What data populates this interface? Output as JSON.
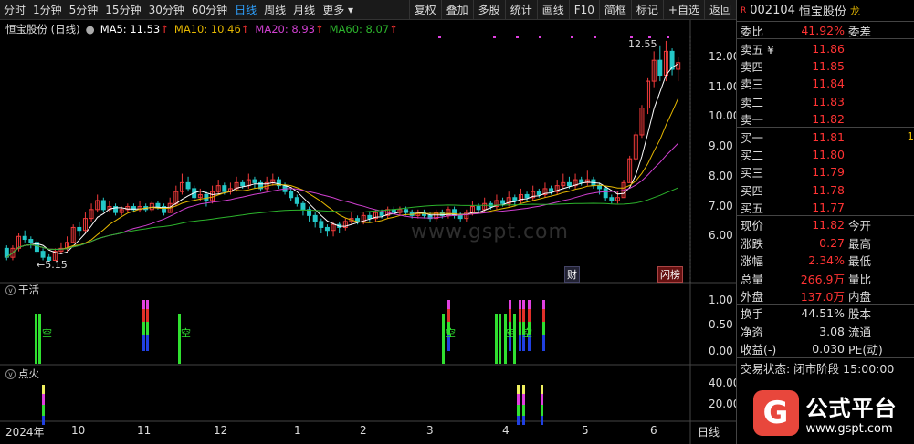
{
  "toolbar": {
    "periods": [
      "分时",
      "1分钟",
      "5分钟",
      "15分钟",
      "30分钟",
      "60分钟",
      "日线",
      "周线",
      "月线",
      "更多"
    ],
    "more_arrow": "▾",
    "active_period": "日线",
    "tools": [
      "复权",
      "叠加",
      "多股",
      "统计",
      "画线",
      "F10",
      "简框",
      "标记",
      "+自选",
      "返回"
    ]
  },
  "legend": {
    "title": "恒宝股份 (日线)",
    "ma5": "MA5: 11.53",
    "ma10": "MA10: 10.46",
    "ma20": "MA20: 8.93",
    "ma60": "MA60: 8.07",
    "arrow": "↑",
    "colors": {
      "ma5": "#ffffff",
      "ma10": "#e6b800",
      "ma20": "#d040d0",
      "ma60": "#2cb32c",
      "up": "#f03a3a",
      "down": "#24c7c7",
      "sub_yellow": "#f0f060",
      "sub_magenta": "#e040e0",
      "sub_red": "#e0302a",
      "sub_green": "#30e030",
      "sub_blue": "#2040e0"
    }
  },
  "price_axis": {
    "ticks": [
      "12.00",
      "11.00",
      "10.00",
      "9.00",
      "8.00",
      "7.00",
      "6.00"
    ]
  },
  "annotations": {
    "high": "12.55",
    "low": "5.15",
    "tag_cai": "财",
    "tag_shi": "闪榜"
  },
  "sub1": {
    "title": "干活",
    "ticks": [
      "1.00",
      "0.50",
      "0.00"
    ],
    "label": "空"
  },
  "sub2": {
    "title": "点火",
    "ticks": [
      "40.00",
      "20.00"
    ]
  },
  "x_axis": {
    "labels": [
      "2024年",
      "10",
      "11",
      "12",
      "1",
      "2",
      "3",
      "4",
      "5",
      "6"
    ],
    "right_label": "日线"
  },
  "watermark": "www.gspt.com",
  "chart_data": {
    "type": "candlestick",
    "ylim": [
      5.0,
      12.7
    ],
    "candles": [
      [
        5.6,
        5.3,
        5.7,
        5.2
      ],
      [
        5.3,
        5.6,
        5.7,
        5.2
      ],
      [
        5.6,
        6.0,
        6.1,
        5.5
      ],
      [
        6.0,
        5.9,
        6.2,
        5.8
      ],
      [
        5.9,
        5.8,
        6.0,
        5.6
      ],
      [
        5.8,
        5.5,
        5.9,
        5.4
      ],
      [
        5.5,
        5.3,
        5.6,
        5.2
      ],
      [
        5.3,
        5.2,
        5.4,
        5.15
      ],
      [
        5.2,
        5.5,
        5.6,
        5.2
      ],
      [
        5.5,
        5.6,
        5.8,
        5.4
      ],
      [
        5.6,
        5.8,
        6.0,
        5.5
      ],
      [
        5.8,
        6.3,
        6.4,
        5.8
      ],
      [
        6.3,
        6.2,
        6.5,
        6.0
      ],
      [
        6.2,
        6.6,
        6.8,
        6.1
      ],
      [
        6.6,
        6.9,
        7.1,
        6.5
      ],
      [
        6.9,
        7.2,
        7.4,
        6.8
      ],
      [
        7.2,
        6.9,
        7.3,
        6.8
      ],
      [
        6.9,
        7.0,
        7.2,
        6.8
      ],
      [
        7.0,
        6.8,
        7.1,
        6.7
      ],
      [
        6.8,
        6.9,
        7.0,
        6.7
      ],
      [
        6.9,
        7.0,
        7.1,
        6.8
      ],
      [
        7.0,
        6.9,
        7.1,
        6.8
      ],
      [
        6.9,
        7.0,
        7.2,
        6.8
      ],
      [
        7.0,
        6.9,
        7.1,
        6.8
      ],
      [
        6.9,
        7.1,
        7.2,
        6.8
      ],
      [
        7.1,
        7.0,
        7.2,
        6.9
      ],
      [
        7.0,
        6.8,
        7.1,
        6.7
      ],
      [
        6.8,
        7.1,
        7.3,
        6.8
      ],
      [
        7.1,
        7.5,
        7.7,
        7.0
      ],
      [
        7.5,
        7.8,
        8.1,
        7.4
      ],
      [
        7.8,
        7.6,
        8.0,
        7.5
      ],
      [
        7.6,
        7.3,
        7.7,
        7.2
      ],
      [
        7.3,
        7.4,
        7.6,
        7.2
      ],
      [
        7.4,
        7.2,
        7.5,
        7.0
      ],
      [
        7.2,
        7.5,
        7.7,
        7.1
      ],
      [
        7.5,
        7.7,
        7.9,
        7.4
      ],
      [
        7.7,
        7.5,
        7.8,
        7.4
      ],
      [
        7.5,
        7.6,
        7.8,
        7.4
      ],
      [
        7.6,
        7.8,
        8.0,
        7.5
      ],
      [
        7.8,
        7.7,
        7.9,
        7.6
      ],
      [
        7.7,
        7.9,
        8.1,
        7.6
      ],
      [
        7.9,
        7.8,
        8.0,
        7.6
      ],
      [
        7.8,
        7.6,
        7.9,
        7.5
      ],
      [
        7.6,
        7.8,
        8.0,
        7.5
      ],
      [
        7.8,
        7.9,
        8.1,
        7.7
      ],
      [
        7.9,
        7.7,
        8.0,
        7.6
      ],
      [
        7.7,
        7.5,
        7.8,
        7.4
      ],
      [
        7.5,
        7.3,
        7.6,
        7.2
      ],
      [
        7.3,
        7.1,
        7.4,
        7.0
      ],
      [
        7.1,
        6.9,
        7.2,
        6.7
      ],
      [
        6.9,
        6.7,
        7.0,
        6.5
      ],
      [
        6.7,
        6.5,
        6.8,
        6.3
      ],
      [
        6.5,
        6.3,
        6.6,
        6.1
      ],
      [
        6.3,
        6.2,
        6.4,
        6.0
      ],
      [
        6.2,
        6.4,
        6.5,
        6.0
      ],
      [
        6.4,
        6.3,
        6.5,
        6.1
      ],
      [
        6.3,
        6.5,
        6.6,
        6.2
      ],
      [
        6.5,
        6.6,
        6.8,
        6.4
      ],
      [
        6.6,
        6.5,
        6.7,
        6.4
      ],
      [
        6.5,
        6.7,
        6.8,
        6.4
      ],
      [
        6.7,
        6.6,
        6.8,
        6.5
      ],
      [
        6.6,
        6.8,
        6.9,
        6.5
      ],
      [
        6.8,
        6.7,
        6.9,
        6.6
      ],
      [
        6.7,
        6.9,
        7.0,
        6.6
      ],
      [
        6.9,
        6.8,
        7.0,
        6.7
      ],
      [
        6.8,
        6.9,
        7.0,
        6.7
      ],
      [
        6.9,
        6.8,
        7.0,
        6.7
      ],
      [
        6.8,
        6.7,
        6.9,
        6.6
      ],
      [
        6.7,
        6.8,
        6.9,
        6.6
      ],
      [
        6.8,
        6.7,
        6.9,
        6.6
      ],
      [
        6.7,
        6.6,
        6.8,
        6.5
      ],
      [
        6.6,
        6.8,
        6.9,
        6.5
      ],
      [
        6.8,
        6.7,
        6.9,
        6.6
      ],
      [
        6.7,
        6.9,
        7.0,
        6.6
      ],
      [
        6.9,
        6.7,
        7.0,
        6.6
      ],
      [
        6.7,
        6.6,
        6.8,
        6.5
      ],
      [
        6.6,
        6.8,
        6.9,
        6.5
      ],
      [
        6.8,
        7.0,
        7.2,
        6.7
      ],
      [
        7.0,
        6.9,
        7.1,
        6.8
      ],
      [
        6.9,
        7.1,
        7.3,
        6.8
      ],
      [
        7.1,
        7.0,
        7.2,
        6.9
      ],
      [
        7.0,
        7.2,
        7.4,
        6.9
      ],
      [
        7.2,
        7.1,
        7.3,
        7.0
      ],
      [
        7.1,
        7.3,
        7.5,
        7.0
      ],
      [
        7.3,
        7.2,
        7.4,
        7.0
      ],
      [
        7.2,
        7.4,
        7.6,
        7.1
      ],
      [
        7.4,
        7.3,
        7.5,
        7.2
      ],
      [
        7.3,
        7.5,
        7.7,
        7.2
      ],
      [
        7.5,
        7.4,
        7.6,
        7.3
      ],
      [
        7.4,
        7.6,
        7.8,
        7.3
      ],
      [
        7.6,
        7.5,
        7.7,
        7.4
      ],
      [
        7.5,
        7.7,
        7.9,
        7.4
      ],
      [
        7.7,
        7.8,
        8.1,
        7.6
      ],
      [
        7.8,
        7.7,
        8.0,
        7.6
      ],
      [
        7.7,
        7.9,
        8.1,
        7.6
      ],
      [
        7.9,
        7.8,
        8.0,
        7.7
      ],
      [
        7.8,
        7.9,
        8.2,
        7.7
      ],
      [
        7.9,
        7.7,
        8.0,
        7.6
      ],
      [
        7.7,
        7.6,
        7.8,
        7.4
      ],
      [
        7.6,
        7.3,
        7.7,
        7.2
      ],
      [
        7.3,
        7.2,
        7.4,
        7.1
      ],
      [
        7.2,
        7.3,
        7.5,
        7.1
      ],
      [
        7.3,
        7.8,
        7.9,
        7.3
      ],
      [
        7.8,
        8.6,
        8.7,
        7.8
      ],
      [
        8.6,
        9.4,
        9.5,
        8.5
      ],
      [
        9.4,
        10.3,
        10.4,
        9.3
      ],
      [
        10.3,
        11.2,
        11.3,
        10.1
      ],
      [
        11.2,
        11.9,
        12.2,
        11.0
      ],
      [
        11.9,
        11.4,
        12.4,
        11.2
      ],
      [
        11.4,
        12.2,
        12.55,
        11.2
      ],
      [
        12.2,
        11.6,
        12.3,
        11.4
      ],
      [
        11.6,
        11.82,
        12.0,
        11.2
      ]
    ]
  }
}
